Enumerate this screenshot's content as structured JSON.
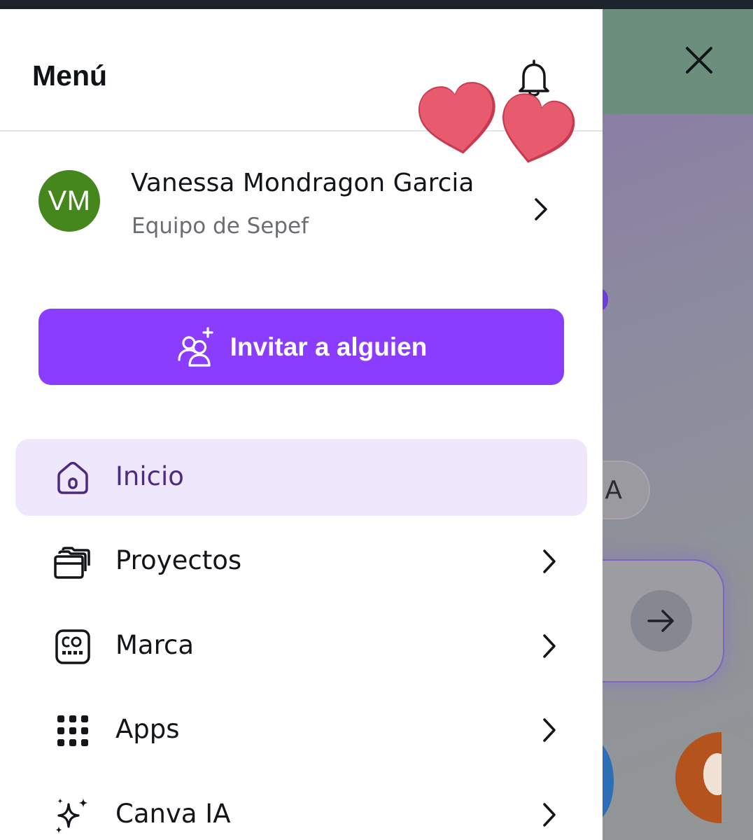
{
  "menu": {
    "title": "Menú",
    "notifications_icon": "bell-icon"
  },
  "profile": {
    "initials": "VM",
    "name": "Vanessa Mondragon Garcia",
    "team": "Equipo de Sepef",
    "avatar_color": "#45861d"
  },
  "invite": {
    "label": "Invitar a alguien",
    "icon": "invite-people-icon",
    "color": "#8b3dff"
  },
  "nav": {
    "items": [
      {
        "label": "Inicio",
        "icon": "home-icon",
        "active": true,
        "has_chevron": false
      },
      {
        "label": "Proyectos",
        "icon": "folder-icon",
        "active": false,
        "has_chevron": true
      },
      {
        "label": "Marca",
        "icon": "brand-icon",
        "active": false,
        "has_chevron": true
      },
      {
        "label": "Apps",
        "icon": "apps-grid-icon",
        "active": false,
        "has_chevron": true
      },
      {
        "label": "Canva IA",
        "icon": "sparkles-icon",
        "active": false,
        "has_chevron": true
      }
    ]
  },
  "background": {
    "pill_text": "A",
    "close_icon": "close-icon"
  },
  "colors": {
    "active_item_bg": "#efe8fd",
    "active_item_text": "#4d2b82",
    "overlay_top": "#6b8e7d"
  }
}
